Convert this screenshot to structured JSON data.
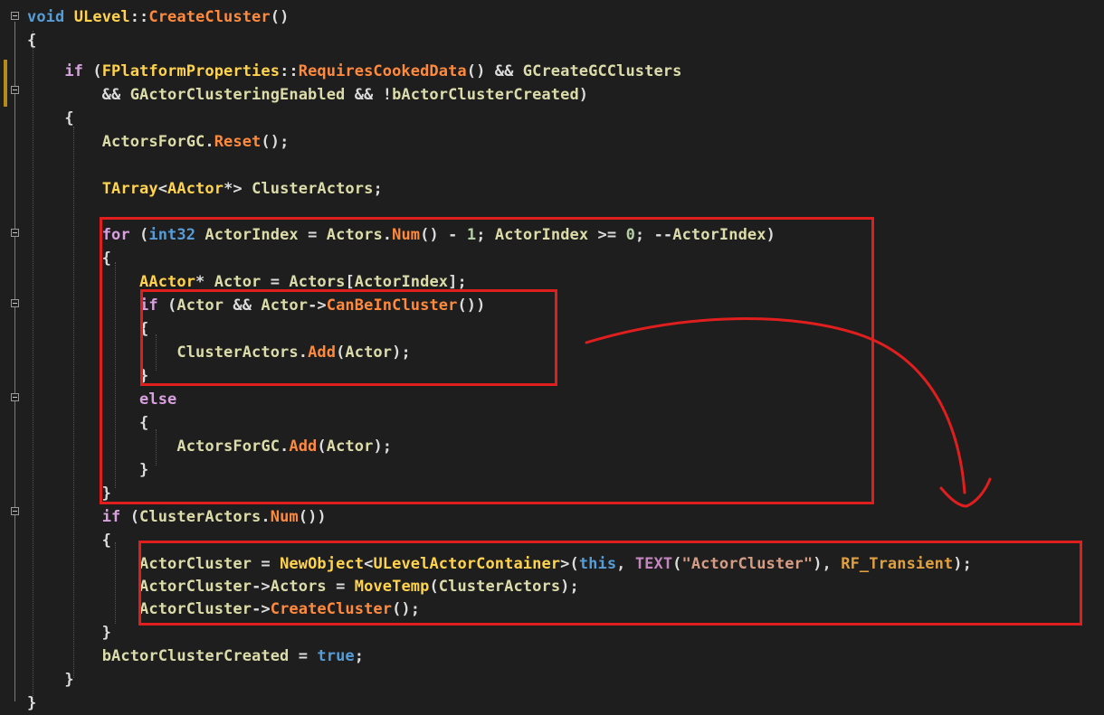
{
  "editor": {
    "lines": [
      {
        "parts": [
          [
            "kw",
            "void"
          ],
          [
            "pl",
            " "
          ],
          [
            "cls",
            "ULevel"
          ],
          [
            "pl",
            "::"
          ],
          [
            "fn",
            "CreateCluster"
          ],
          [
            "pl",
            "()"
          ]
        ]
      },
      {
        "parts": [
          [
            "brace",
            "{"
          ]
        ]
      },
      {
        "parts": [
          [
            "pl",
            "    "
          ],
          [
            "ctl",
            "if"
          ],
          [
            "pl",
            " ("
          ],
          [
            "cls",
            "FPlatformProperties"
          ],
          [
            "pl",
            "::"
          ],
          [
            "fn",
            "RequiresCookedData"
          ],
          [
            "pl",
            "() && "
          ],
          [
            "var",
            "GCreateGCClusters"
          ]
        ]
      },
      {
        "parts": [
          [
            "pl",
            "        && "
          ],
          [
            "var",
            "GActorClusteringEnabled"
          ],
          [
            "pl",
            " && !"
          ],
          [
            "var",
            "bActorClusterCreated"
          ],
          [
            "pl",
            ")"
          ]
        ]
      },
      {
        "parts": [
          [
            "pl",
            "    {"
          ]
        ]
      },
      {
        "parts": [
          [
            "pl",
            "        "
          ],
          [
            "var",
            "ActorsForGC"
          ],
          [
            "pl",
            "."
          ],
          [
            "fn",
            "Reset"
          ],
          [
            "pl",
            "();"
          ]
        ]
      },
      {
        "parts": [
          [
            "pl",
            ""
          ]
        ]
      },
      {
        "parts": [
          [
            "pl",
            "        "
          ],
          [
            "cls",
            "TArray"
          ],
          [
            "pl",
            "<"
          ],
          [
            "cls",
            "AActor"
          ],
          [
            "pl",
            "*> "
          ],
          [
            "var",
            "ClusterActors"
          ],
          [
            "pl",
            ";"
          ]
        ]
      },
      {
        "parts": [
          [
            "pl",
            ""
          ]
        ]
      },
      {
        "parts": [
          [
            "pl",
            "        "
          ],
          [
            "ctl",
            "for"
          ],
          [
            "pl",
            " ("
          ],
          [
            "kw",
            "int32"
          ],
          [
            "pl",
            " "
          ],
          [
            "var",
            "ActorIndex"
          ],
          [
            "pl",
            " = "
          ],
          [
            "var",
            "Actors"
          ],
          [
            "pl",
            "."
          ],
          [
            "fn",
            "Num"
          ],
          [
            "pl",
            "() - "
          ],
          [
            "num",
            "1"
          ],
          [
            "pl",
            "; "
          ],
          [
            "var",
            "ActorIndex"
          ],
          [
            "pl",
            " >= "
          ],
          [
            "num",
            "0"
          ],
          [
            "pl",
            "; --"
          ],
          [
            "var",
            "ActorIndex"
          ],
          [
            "pl",
            ")"
          ]
        ]
      },
      {
        "parts": [
          [
            "pl",
            "        {"
          ]
        ]
      },
      {
        "parts": [
          [
            "pl",
            "            "
          ],
          [
            "cls",
            "AActor"
          ],
          [
            "pl",
            "* "
          ],
          [
            "var",
            "Actor"
          ],
          [
            "pl",
            " = "
          ],
          [
            "var",
            "Actors"
          ],
          [
            "pl",
            "["
          ],
          [
            "var",
            "ActorIndex"
          ],
          [
            "pl",
            "];"
          ]
        ]
      },
      {
        "parts": [
          [
            "pl",
            "            "
          ],
          [
            "ctl",
            "if"
          ],
          [
            "pl",
            " ("
          ],
          [
            "var",
            "Actor"
          ],
          [
            "pl",
            " && "
          ],
          [
            "var",
            "Actor"
          ],
          [
            "pl",
            "->"
          ],
          [
            "fn",
            "CanBeInCluster"
          ],
          [
            "pl",
            "())"
          ]
        ]
      },
      {
        "parts": [
          [
            "pl",
            "            {"
          ]
        ]
      },
      {
        "parts": [
          [
            "pl",
            "                "
          ],
          [
            "var",
            "ClusterActors"
          ],
          [
            "pl",
            "."
          ],
          [
            "fn",
            "Add"
          ],
          [
            "pl",
            "("
          ],
          [
            "var",
            "Actor"
          ],
          [
            "pl",
            ");"
          ]
        ]
      },
      {
        "parts": [
          [
            "pl",
            "            }"
          ]
        ]
      },
      {
        "parts": [
          [
            "pl",
            "            "
          ],
          [
            "ctl",
            "else"
          ]
        ]
      },
      {
        "parts": [
          [
            "pl",
            "            {"
          ]
        ]
      },
      {
        "parts": [
          [
            "pl",
            "                "
          ],
          [
            "var",
            "ActorsForGC"
          ],
          [
            "pl",
            "."
          ],
          [
            "fn",
            "Add"
          ],
          [
            "pl",
            "("
          ],
          [
            "var",
            "Actor"
          ],
          [
            "pl",
            ");"
          ]
        ]
      },
      {
        "parts": [
          [
            "pl",
            "            }"
          ]
        ]
      },
      {
        "parts": [
          [
            "pl",
            "        }"
          ]
        ]
      },
      {
        "parts": [
          [
            "pl",
            "        "
          ],
          [
            "ctl",
            "if"
          ],
          [
            "pl",
            " ("
          ],
          [
            "var",
            "ClusterActors"
          ],
          [
            "pl",
            "."
          ],
          [
            "fn",
            "Num"
          ],
          [
            "pl",
            "())"
          ]
        ]
      },
      {
        "parts": [
          [
            "pl",
            "        {"
          ]
        ]
      },
      {
        "parts": [
          [
            "pl",
            "            "
          ],
          [
            "var",
            "ActorCluster"
          ],
          [
            "pl",
            " = "
          ],
          [
            "cls",
            "NewObject"
          ],
          [
            "pl",
            "<"
          ],
          [
            "cls",
            "ULevelActorContainer"
          ],
          [
            "pl",
            ">("
          ],
          [
            "kw",
            "this"
          ],
          [
            "pl",
            ", "
          ],
          [
            "mac",
            "TEXT"
          ],
          [
            "pl",
            "("
          ],
          [
            "str",
            "\"ActorCluster\""
          ],
          [
            "pl",
            "), "
          ],
          [
            "enm",
            "RF_Transient"
          ],
          [
            "pl",
            ");"
          ]
        ]
      },
      {
        "parts": [
          [
            "pl",
            "            "
          ],
          [
            "var",
            "ActorCluster"
          ],
          [
            "pl",
            "->"
          ],
          [
            "var",
            "Actors"
          ],
          [
            "pl",
            " = "
          ],
          [
            "cls",
            "MoveTemp"
          ],
          [
            "pl",
            "("
          ],
          [
            "var",
            "ClusterActors"
          ],
          [
            "pl",
            ");"
          ]
        ]
      },
      {
        "parts": [
          [
            "pl",
            "            "
          ],
          [
            "var",
            "ActorCluster"
          ],
          [
            "pl",
            "->"
          ],
          [
            "fn",
            "CreateCluster"
          ],
          [
            "pl",
            "();"
          ]
        ]
      },
      {
        "parts": [
          [
            "pl",
            "        }"
          ]
        ]
      },
      {
        "parts": [
          [
            "pl",
            "        "
          ],
          [
            "var",
            "bActorClusterCreated"
          ],
          [
            "pl",
            " = "
          ],
          [
            "kw",
            "true"
          ],
          [
            "pl",
            ";"
          ]
        ]
      },
      {
        "parts": [
          [
            "pl",
            "    }"
          ]
        ]
      },
      {
        "parts": [
          [
            "pl",
            "}"
          ]
        ]
      }
    ]
  },
  "colors": {
    "background": "#1e1e1e",
    "annotation": "#e01e1e",
    "change_marker": "#b58a1a"
  }
}
